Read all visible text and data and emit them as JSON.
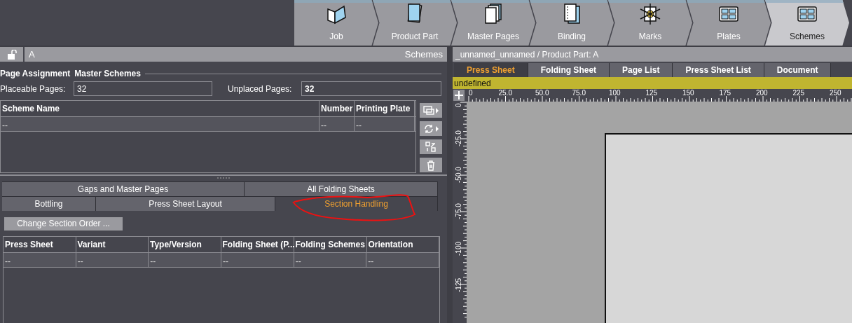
{
  "workflow_steps": [
    {
      "label": "Job",
      "kind": "folder",
      "selected": false
    },
    {
      "label": "Product Part",
      "kind": "sheet",
      "selected": false
    },
    {
      "label": "Master Pages",
      "kind": "stack",
      "selected": false
    },
    {
      "label": "Binding",
      "kind": "binding",
      "selected": false
    },
    {
      "label": "Marks",
      "kind": "marks",
      "selected": false
    },
    {
      "label": "Plates",
      "kind": "plate",
      "selected": false
    },
    {
      "label": "Schemes",
      "kind": "plate",
      "selected": true
    }
  ],
  "left_panel": {
    "locked": false,
    "title": "A",
    "context": "Schemes",
    "section_labels": [
      "Page Assignment",
      "Master Schemes"
    ],
    "fields": [
      {
        "label": "Placeable Pages:",
        "value": "32",
        "bold": false
      },
      {
        "label": "Unplaced Pages:",
        "value": "32",
        "bold": true
      }
    ],
    "scheme_table": {
      "columns": [
        "Scheme Name",
        "Number",
        "Printing Plate"
      ],
      "rows": [
        [
          "--",
          "--",
          "--"
        ]
      ]
    },
    "side_buttons": [
      {
        "kind": "monitor",
        "menu": true
      },
      {
        "kind": "refresh",
        "menu": true
      },
      {
        "kind": "grid",
        "menu": false
      },
      {
        "kind": "trash",
        "menu": false
      }
    ],
    "tab_rows": [
      [
        {
          "label": "Gaps and Master Pages",
          "selected": false
        },
        {
          "label": "All Folding Sheets",
          "selected": false
        }
      ],
      [
        {
          "label": "Bottling",
          "selected": false
        },
        {
          "label": "Press Sheet Layout",
          "selected": false
        },
        {
          "label": "Section Handling",
          "selected": true
        }
      ]
    ],
    "action_button": "Change Section Order ...",
    "press_sheet_table": {
      "columns": [
        "Press Sheet",
        "Variant",
        "Type/Version",
        "Folding Sheet (P...",
        "Folding Schemes",
        "Orientation"
      ],
      "rows": [
        [
          "--",
          "--",
          "--",
          "--",
          "--",
          "--"
        ]
      ]
    }
  },
  "right_panel": {
    "title": "_unnamed_unnamed / Product Part: A",
    "tabs": [
      {
        "label": "Press Sheet",
        "selected": true
      },
      {
        "label": "Folding Sheet",
        "selected": false
      },
      {
        "label": "Page List",
        "selected": false
      },
      {
        "label": "Press Sheet List",
        "selected": false
      },
      {
        "label": "Document",
        "selected": false
      }
    ],
    "status": "undefined",
    "h_ruler": [
      "0",
      "25.0",
      "50.0",
      "75.0",
      "100",
      "125",
      "150",
      "175",
      "200",
      "225",
      "250"
    ],
    "v_ruler": [
      "0.",
      "-25.0",
      "-50.0",
      "-75.0",
      "-100",
      "-125"
    ]
  }
}
